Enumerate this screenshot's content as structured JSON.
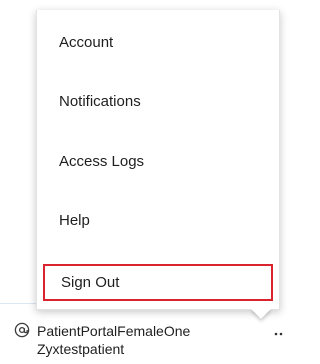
{
  "menu": {
    "items": [
      {
        "label": "Account"
      },
      {
        "label": "Notifications"
      },
      {
        "label": "Access Logs"
      },
      {
        "label": "Help"
      }
    ],
    "sign_out_label": "Sign Out",
    "highlight_color": "#d9232e"
  },
  "user": {
    "icon": "at-icon",
    "name_line1": "PatientPortalFemaleOne",
    "name_line2": "Zyxtestpatient",
    "more_icon": "ellipsis-icon"
  }
}
